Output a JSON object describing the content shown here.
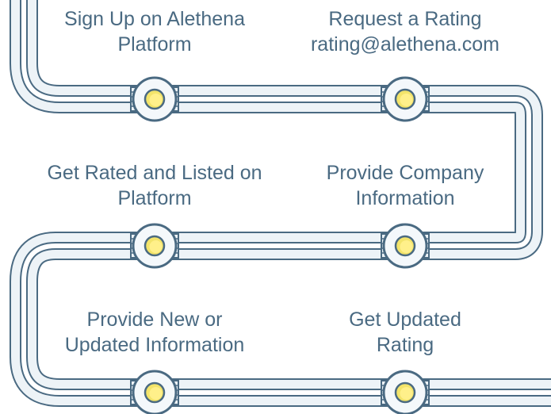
{
  "steps": [
    {
      "id": "signup",
      "line1": "Sign Up on Alethena",
      "line2": "Platform"
    },
    {
      "id": "request-rating",
      "line1": "Request a Rating",
      "line2": "rating@alethena.com"
    },
    {
      "id": "get-rated",
      "line1": "Get Rated and Listed on",
      "line2": "Platform"
    },
    {
      "id": "provide-company",
      "line1": "Provide Company",
      "line2": "Information"
    },
    {
      "id": "provide-new",
      "line1": "Provide New or",
      "line2": "Updated Information"
    },
    {
      "id": "get-updated",
      "line1": "Get Updated",
      "line2": "Rating"
    }
  ],
  "colors": {
    "text": "#4a6a82",
    "pipe_outline": "#4a6a82",
    "pipe_fill": "#edf3f7",
    "pipe_fill_inner": "#ffffff",
    "node_light": "#f3e46a",
    "node_light_inner": "#fff08a"
  }
}
